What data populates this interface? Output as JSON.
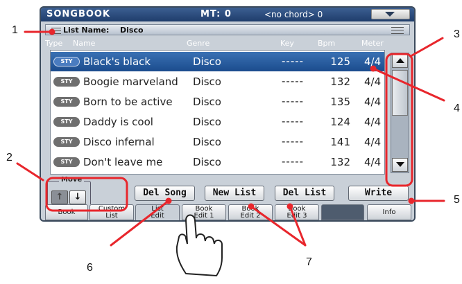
{
  "header": {
    "title": "SONGBOOK",
    "mt": "MT: 0",
    "chord": "<no chord> 0"
  },
  "list_name": {
    "label": "List Name:",
    "value": "Disco"
  },
  "columns": [
    "Type",
    "Name",
    "Genre",
    "Key",
    "Bpm",
    "Meter"
  ],
  "rows": [
    {
      "type": "STY",
      "name": "Black's black",
      "genre": "Disco",
      "key": "-----",
      "bpm": "125",
      "meter": "4/4",
      "selected": true
    },
    {
      "type": "STY",
      "name": "Boogie marveland",
      "genre": "Disco",
      "key": "-----",
      "bpm": "132",
      "meter": "4/4"
    },
    {
      "type": "STY",
      "name": "Born to be active",
      "genre": "Disco",
      "key": "-----",
      "bpm": "135",
      "meter": "4/4"
    },
    {
      "type": "STY",
      "name": "Daddy is cool",
      "genre": "Disco",
      "key": "-----",
      "bpm": "124",
      "meter": "4/4"
    },
    {
      "type": "STY",
      "name": "Disco infernal",
      "genre": "Disco",
      "key": "-----",
      "bpm": "141",
      "meter": "4/4"
    },
    {
      "type": "STY",
      "name": "Don't leave me",
      "genre": "Disco",
      "key": "-----",
      "bpm": "132",
      "meter": "4/4"
    }
  ],
  "move": {
    "label": "Move",
    "up": "↑",
    "down": "↓"
  },
  "buttons": {
    "del_song": "Del Song",
    "new_list": "New List",
    "del_list": "Del List",
    "write": "Write"
  },
  "tabs": [
    {
      "line1": "Book",
      "line2": ""
    },
    {
      "line1": "Custom",
      "line2": "List"
    },
    {
      "line1": "List",
      "line2": "Edit"
    },
    {
      "line1": "Book",
      "line2": "Edit 1"
    },
    {
      "line1": "Book",
      "line2": "Edit 2"
    },
    {
      "line1": "Book",
      "line2": "Edit 3"
    },
    {
      "line1": "Info",
      "line2": ""
    }
  ],
  "callouts": [
    "1",
    "2",
    "3",
    "4",
    "5",
    "6",
    "7"
  ],
  "colors": {
    "callout_red": "#e8262c",
    "header_blue": "#1f3d6b",
    "selection_blue": "#2a5ea2"
  }
}
